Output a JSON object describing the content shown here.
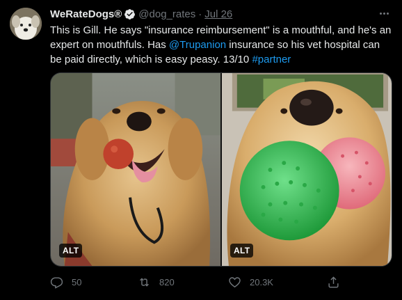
{
  "author": {
    "name": "WeRateDogs®",
    "handle": "@dog_rates",
    "separator": "·",
    "date": "Jul 26"
  },
  "tweet": {
    "text_1": "This is Gill. He says \"insurance reimbursement\" is a mouthful, and he's an expert on mouthfuls. Has ",
    "mention": "@Trupanion",
    "text_2": " insurance so his vet hospital can be paid directly, which is easy peasy. 13/10 ",
    "hashtag": "#partner"
  },
  "media": {
    "alt_left": "ALT",
    "alt_right": "ALT"
  },
  "actions": {
    "reply_count": "50",
    "retweet_count": "820",
    "like_count": "20.3K"
  },
  "icons": {
    "verified": "verified-badge-icon",
    "more": "more-options-icon",
    "reply": "reply-icon",
    "retweet": "retweet-icon",
    "like": "heart-icon",
    "share": "share-icon"
  },
  "colors": {
    "background": "#000000",
    "text": "#e7e9ea",
    "secondary": "#71767b",
    "link": "#1d9bf0"
  }
}
